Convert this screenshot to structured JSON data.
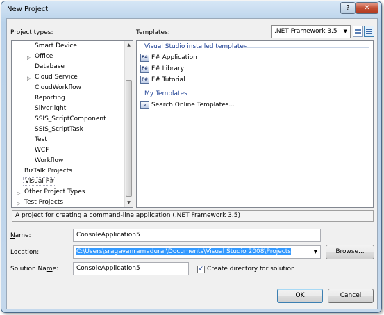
{
  "window": {
    "title": "New Project"
  },
  "labels": {
    "project_types": "Project types:",
    "templates": "Templates:"
  },
  "framework": {
    "selected": ".NET Framework 3.5"
  },
  "project_types": [
    {
      "label": "Smart Device",
      "expandable": false
    },
    {
      "label": "Office",
      "expandable": true
    },
    {
      "label": "Database",
      "expandable": false
    },
    {
      "label": "Cloud Service",
      "expandable": true
    },
    {
      "label": "CloudWorkflow",
      "expandable": false
    },
    {
      "label": "Reporting",
      "expandable": false
    },
    {
      "label": "Silverlight",
      "expandable": false
    },
    {
      "label": "SSIS_ScriptComponent",
      "expandable": false
    },
    {
      "label": "SSIS_ScriptTask",
      "expandable": false
    },
    {
      "label": "Test",
      "expandable": false
    },
    {
      "label": "WCF",
      "expandable": false
    },
    {
      "label": "Workflow",
      "expandable": false
    },
    {
      "label": "BizTalk Projects",
      "expandable": false
    },
    {
      "label": "Visual F#",
      "expandable": false,
      "selected": true
    },
    {
      "label": "Other Project Types",
      "expandable": true
    },
    {
      "label": "Test Projects",
      "expandable": true
    }
  ],
  "templates": {
    "installed_header": "Visual Studio installed templates",
    "installed": [
      "F# Application",
      "F# Library",
      "F# Tutorial"
    ],
    "my_header": "My Templates",
    "my": [
      "Search Online Templates..."
    ]
  },
  "description": "A project for creating a command-line application (.NET Framework 3.5)",
  "form": {
    "name_label": "Name:",
    "name_value": "ConsoleApplication5",
    "location_label": "Location:",
    "location_value": "C:\\Users\\sragavanramadurai\\Documents\\Visual Studio 2008\\Projects",
    "browse_label": "Browse...",
    "solution_label": "Solution Name:",
    "solution_value": "ConsoleApplication5",
    "create_dir_label": "Create directory for solution",
    "create_dir_checked": true
  },
  "buttons": {
    "ok": "OK",
    "cancel": "Cancel"
  },
  "colors": {
    "accent": "#3399ff",
    "group_header": "#1c3f94"
  }
}
